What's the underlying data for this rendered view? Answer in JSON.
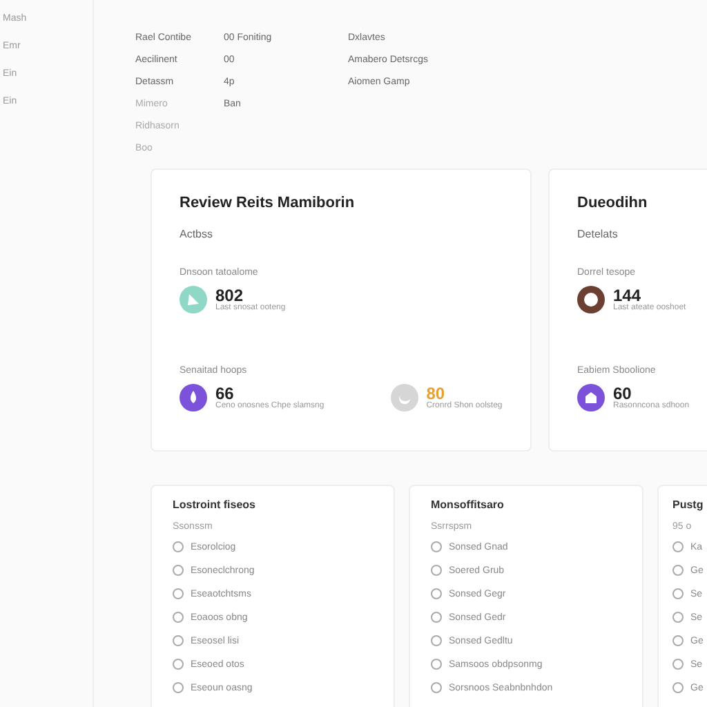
{
  "sidebar": {
    "items": [
      {
        "label": "Mash"
      },
      {
        "label": "Emr"
      },
      {
        "label": "Ein"
      },
      {
        "label": "Ein"
      }
    ]
  },
  "details": {
    "columns": [
      {
        "items": [
          "Rael Contibe",
          "Aecilinent",
          "Detassm",
          "Mimero",
          "Ridhasorn",
          "Boo"
        ]
      },
      {
        "items": [
          "00  Foniting",
          "00",
          "4p",
          "Ban"
        ]
      },
      {
        "items": [
          "Dxlavtes",
          "Amabero Detsrcgs",
          "Aiomen Gamp"
        ]
      }
    ]
  },
  "cards": [
    {
      "title": "Review Reits Mamiborin",
      "subtitle": "Actbss",
      "sections": [
        {
          "label": "Dnsoon tatoalome",
          "metrics": [
            {
              "kind": "leaf",
              "color": "#8fd8c8",
              "value": "802",
              "highlighted": false,
              "caption": "Last snosat ooteng"
            }
          ]
        },
        {
          "label": "Senaitad hoops",
          "metrics": [
            {
              "kind": "drop",
              "color": "#7b52d9",
              "value": "66",
              "highlighted": false,
              "caption": "Ceno onosnes Chpe slamsng"
            },
            {
              "kind": "moon",
              "color": "#d6d6d6",
              "value": "80",
              "highlighted": true,
              "caption": "Cronrd Shon oolsteg"
            }
          ]
        }
      ]
    },
    {
      "title": "Dueodihn",
      "subtitle": "Detelats",
      "sections": [
        {
          "label": "Dorrel tesope",
          "metrics": [
            {
              "kind": "ring",
              "color": "#6b3f32",
              "value": "144",
              "highlighted": false,
              "caption": "Last ateate ooshoet"
            }
          ]
        },
        {
          "label": "Eabiem Sboolione",
          "metrics": [
            {
              "kind": "house",
              "color": "#7b52d9",
              "value": "60",
              "highlighted": false,
              "caption": "Rasonncona sdhoon"
            }
          ]
        }
      ]
    }
  ],
  "lists": [
    {
      "title": "Lostroint fiseos",
      "subtitle": "Ssonssm",
      "options": [
        {
          "label": "Esorolciog",
          "checked": false
        },
        {
          "label": "Esoneclchrong",
          "checked": false
        },
        {
          "label": "Eseaotchtsms",
          "checked": false
        },
        {
          "label": "Eoaoos obng",
          "checked": false
        },
        {
          "label": "Eseosel lisi",
          "checked": false
        },
        {
          "label": "Eseoed otos",
          "checked": false
        },
        {
          "label": "Eseoun oasng",
          "checked": false
        }
      ]
    },
    {
      "title": "Monsoffitsaro",
      "subtitle": "Ssrrspsm",
      "options": [
        {
          "label": "Sonsed Gnad",
          "checked": false
        },
        {
          "label": "Soered Grub",
          "checked": false
        },
        {
          "label": "Sonsed Gegr",
          "checked": false
        },
        {
          "label": "Sonsed Gedr",
          "checked": false
        },
        {
          "label": "Sonsed Gedltu",
          "checked": false
        },
        {
          "label": "Samsoos obdpsonmg",
          "checked": false
        },
        {
          "label": "Sorsnoos Seabnbnhdon",
          "checked": false
        }
      ]
    },
    {
      "title": "Pustg",
      "subtitle": "95 o",
      "options": [
        {
          "label": "Ka",
          "checked": false
        },
        {
          "label": "Ge",
          "checked": false
        },
        {
          "label": "Se",
          "checked": false
        },
        {
          "label": "Se",
          "checked": false
        },
        {
          "label": "Ge",
          "checked": false
        },
        {
          "label": "Se",
          "checked": false
        },
        {
          "label": "Ge",
          "checked": false
        }
      ]
    }
  ]
}
